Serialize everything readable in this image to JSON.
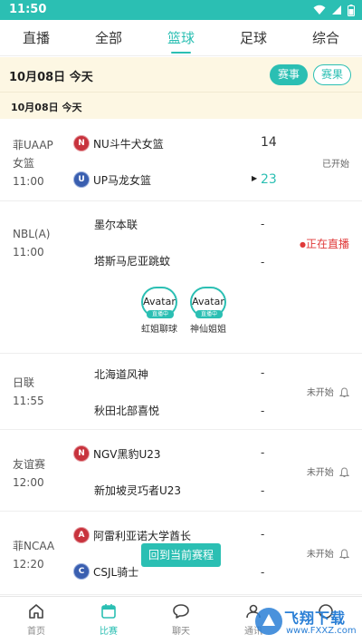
{
  "status_bar": {
    "time": "11:50"
  },
  "tabs": [
    {
      "label": "直播"
    },
    {
      "label": "全部"
    },
    {
      "label": "篮球",
      "active": true
    },
    {
      "label": "足球"
    },
    {
      "label": "综合"
    }
  ],
  "date_header": {
    "label": "10月08日 今天",
    "events_button": "赛事",
    "results_button": "赛果"
  },
  "date_sub": {
    "label": "10月08日 今天"
  },
  "matches": [
    {
      "league": "菲UAAP女篮",
      "league_l1": "菲UAAP",
      "league_l2": "女篮",
      "time": "11:00",
      "home": {
        "name": "NU斗牛犬女篮",
        "badge": "N"
      },
      "away": {
        "name": "UP马龙女篮",
        "badge": "U"
      },
      "home_score": "14",
      "away_score": "23",
      "status": "已开始"
    },
    {
      "league": "NBL(A)",
      "time": "11:00",
      "home": {
        "name": "墨尔本联"
      },
      "away": {
        "name": "塔斯马尼亚跳蚊"
      },
      "home_score": "-",
      "away_score": "-",
      "status": "正在直播",
      "streamers": [
        {
          "avatar_alt": "Avatar",
          "badge": "直播中",
          "name": "虹姐聊球"
        },
        {
          "avatar_alt": "Avatar",
          "badge": "直播中",
          "name": "神仙姐姐"
        }
      ]
    },
    {
      "league": "日联",
      "time": "11:55",
      "home": {
        "name": "北海道风神"
      },
      "away": {
        "name": "秋田北部喜悦"
      },
      "home_score": "-",
      "away_score": "-",
      "status": "未开始"
    },
    {
      "league": "友谊赛",
      "time": "12:00",
      "home": {
        "name": "NGV黑豹U23",
        "badge": "N"
      },
      "away": {
        "name": "新加坡灵巧者U23"
      },
      "home_score": "-",
      "away_score": "-",
      "status": "未开始"
    },
    {
      "league": "菲NCAA",
      "time": "12:20",
      "home": {
        "name": "阿雷利亚诺大学酋长",
        "badge": "A"
      },
      "away": {
        "name": "CSJL骑士",
        "badge": "C"
      },
      "home_score": "-",
      "away_score": "-",
      "status": "未开始"
    }
  ],
  "floating_button": "回到当前赛程",
  "bottom_nav": [
    {
      "label": "首页",
      "icon": "home-icon"
    },
    {
      "label": "比赛",
      "icon": "calendar-icon",
      "active": true
    },
    {
      "label": "聊天",
      "icon": "chat-icon"
    },
    {
      "label": "通讯",
      "icon": "contacts-icon"
    },
    {
      "label": "",
      "icon": "profile-icon"
    }
  ],
  "watermark": {
    "text": "飞翔下载",
    "url": "www.FXXZ.com"
  },
  "colors": {
    "accent": "#2bbfb3",
    "live_red": "#e03a3a",
    "header_bg": "#fdf7e3"
  }
}
